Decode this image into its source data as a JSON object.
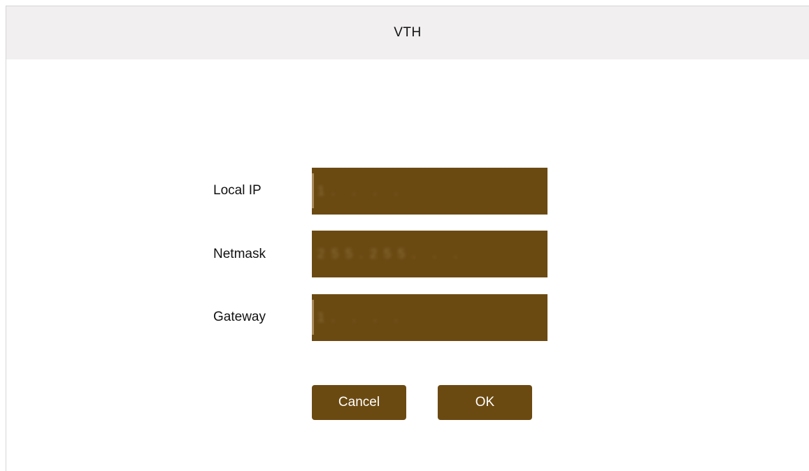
{
  "window": {
    "title": "VTH"
  },
  "form": {
    "fields": [
      {
        "label": "Local IP",
        "value": "1. . . ."
      },
      {
        "label": "Netmask",
        "value": "255.255. . ."
      },
      {
        "label": "Gateway",
        "value": "1. . . ."
      }
    ]
  },
  "buttons": {
    "cancel_label": "Cancel",
    "ok_label": "OK"
  },
  "colors": {
    "accent": "#6b4a12",
    "titlebar": "#f1eff0",
    "text": "#111111",
    "button_text": "#ffffff"
  }
}
